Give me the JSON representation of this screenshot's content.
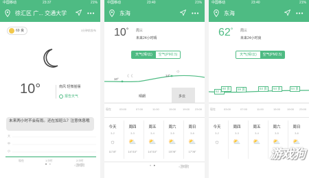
{
  "colors": {
    "accent": "#4ebb83"
  },
  "phone1": {
    "status": {
      "carrier": "中国移动",
      "time": "23:37",
      "battery": "21%"
    },
    "title": "徐汇区 广... 交通大学",
    "aqi": "69 良",
    "published": "3分钟前发布",
    "current_temp": "10°",
    "wind": "南风 轻微摇摆",
    "report": "报告天气",
    "bubble": "未来两小时不会有雨。还在加班么？注意休息哦",
    "chart_axis": {
      "y": [
        "大",
        "中",
        "小"
      ],
      "x": [
        "现在",
        "1小时",
        "2小时"
      ]
    },
    "watermark": "游戏狗"
  },
  "phone2": {
    "status": {
      "carrier": "中国移动",
      "time": "23:40",
      "battery": "21%"
    },
    "title": "东海",
    "temp": "10",
    "unit": "°",
    "day": "周三",
    "forecast": "未来24小时晴",
    "tabs": {
      "weather": "天气(晴/云)",
      "air": "空气(PM2.5)"
    },
    "temp_points": [
      "10°",
      "14°"
    ],
    "conditions": [
      "晴朗",
      "多云"
    ],
    "times": [
      "现在",
      "03:00",
      "07:00",
      "11:00",
      "15:00",
      "19:00",
      "23:00"
    ]
  },
  "phone3": {
    "status": {
      "carrier": "中国移动",
      "time": "23:40",
      "battery": "21%"
    },
    "title": "东海",
    "aqi": "62",
    "unit": "°",
    "day": "周三",
    "forecast": "未来24小时良",
    "tabs": {
      "weather": "天气(晴/云)",
      "air": "空气(PM2.5)"
    },
    "air_points": [
      "62 良",
      "60 良",
      "59 良",
      "54 良",
      "54 良",
      "54 良"
    ],
    "times": [
      "现在",
      "03:00",
      "07:00",
      "11:00",
      "15:00",
      "19:00",
      "23:00"
    ]
  },
  "forecast_days": {
    "days": [
      "今天",
      "周四",
      "周五",
      "周六",
      "周日"
    ],
    "dates": [
      "3-2",
      "3-3",
      "3-4",
      "3-5",
      "3-6"
    ],
    "ranges": [
      "11°/8°",
      "14°/10°",
      "14°/10°",
      "15°/8°",
      "17°/8°"
    ],
    "icons": [
      "sunny-icon",
      "partly-cloudy-icon",
      "partly-cloudy-icon",
      "partly-cloudy-icon",
      "partly-cloudy-icon"
    ]
  }
}
